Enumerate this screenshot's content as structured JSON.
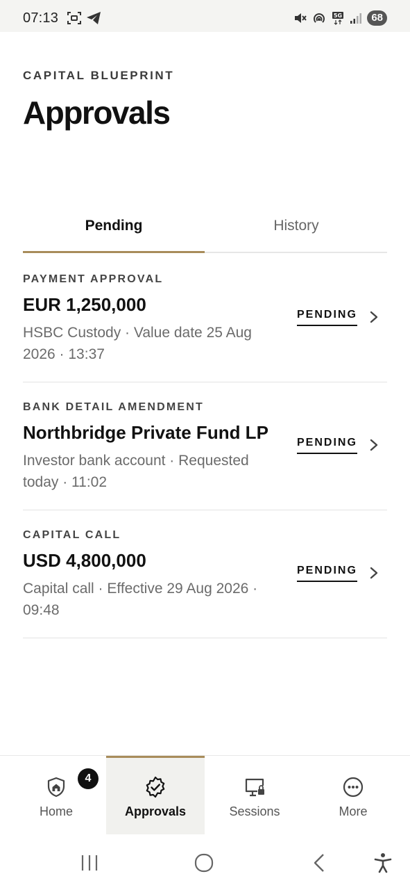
{
  "status_bar": {
    "time": "07:13",
    "battery": "68",
    "icons": [
      "screenshot-icon",
      "telegram-icon",
      "mute-icon",
      "hotspot-icon",
      "5g-icon",
      "signal-icon"
    ]
  },
  "header": {
    "brand": "CAPITAL BLUEPRINT",
    "title": "Approvals"
  },
  "tabs": [
    {
      "label": "Pending",
      "active": true
    },
    {
      "label": "History",
      "active": false
    }
  ],
  "approvals": [
    {
      "type": "PAYMENT APPROVAL",
      "title": "EUR 1,250,000",
      "meta": "HSBC Custody · Value date 25 Aug 2026 · 13:37",
      "status": "PENDING"
    },
    {
      "type": "BANK DETAIL AMENDMENT",
      "title": "Northbridge Private Fund LP",
      "meta": "Investor bank account · Requested today · 11:02",
      "status": "PENDING"
    },
    {
      "type": "CAPITAL CALL",
      "title": "USD 4,800,000",
      "meta": "Capital call · Effective 29 Aug 2026 · 09:48",
      "status": "PENDING"
    }
  ],
  "bottom_nav": [
    {
      "label": "Home",
      "icon": "home-shield-icon",
      "badge": "4",
      "active": false
    },
    {
      "label": "Approvals",
      "icon": "verified-badge-icon",
      "active": true
    },
    {
      "label": "Sessions",
      "icon": "monitor-lock-icon",
      "active": false
    },
    {
      "label": "More",
      "icon": "more-circle-icon",
      "active": false
    }
  ],
  "colors": {
    "accent": "#a88c5a",
    "text": "#111111",
    "muted": "#6b6b6b",
    "divider": "#e3e3e3"
  }
}
